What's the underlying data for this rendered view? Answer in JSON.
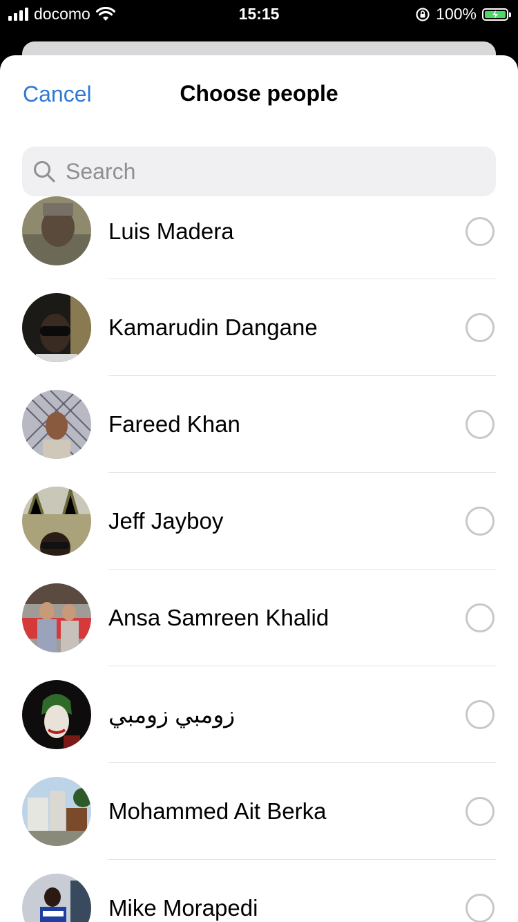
{
  "status_bar": {
    "carrier": "docomo",
    "time": "15:15",
    "battery": "100%",
    "icons": [
      "signal-icon",
      "wifi-icon",
      "orientation-lock-icon",
      "battery-charging-icon"
    ]
  },
  "header": {
    "cancel_label": "Cancel",
    "title": "Choose people"
  },
  "search": {
    "placeholder": "Search",
    "icon": "search-icon"
  },
  "colors": {
    "accent": "#2f78d6",
    "radio_border": "#c7c7cc",
    "search_bg": "#f0f0f2"
  },
  "contacts": [
    {
      "name": "Luis Madera",
      "selected": false
    },
    {
      "name": "Kamarudin Dangane",
      "selected": false
    },
    {
      "name": "Fareed Khan",
      "selected": false
    },
    {
      "name": "Jeff Jayboy",
      "selected": false
    },
    {
      "name": "Ansa Samreen Khalid",
      "selected": false
    },
    {
      "name": "زومبي زومبي",
      "selected": false
    },
    {
      "name": "Mohammed Ait Berka",
      "selected": false
    },
    {
      "name": "Mike Morapedi",
      "selected": false
    }
  ]
}
